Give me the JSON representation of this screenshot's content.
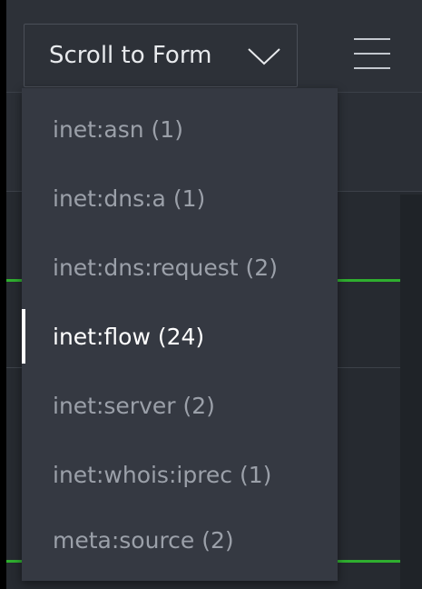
{
  "toolbar": {
    "scroll_button_label": "Scroll to Form",
    "scroll_button_icon": "chevron-down-icon",
    "menu_icon": "hamburger-menu-icon"
  },
  "dropdown": {
    "selected_index": 3,
    "items": [
      {
        "label": "inet:asn (1)"
      },
      {
        "label": "inet:dns:a (1)"
      },
      {
        "label": "inet:dns:request (2)"
      },
      {
        "label": "inet:flow (24)"
      },
      {
        "label": "inet:server (2)"
      },
      {
        "label": "inet:whois:iprec (1)"
      },
      {
        "label": "meta:source (2)"
      }
    ]
  },
  "colors": {
    "accent_green": "#2fae2f",
    "dropdown_bg": "#353942",
    "item_text": "#9ba0a9",
    "active_text": "#ffffff"
  }
}
